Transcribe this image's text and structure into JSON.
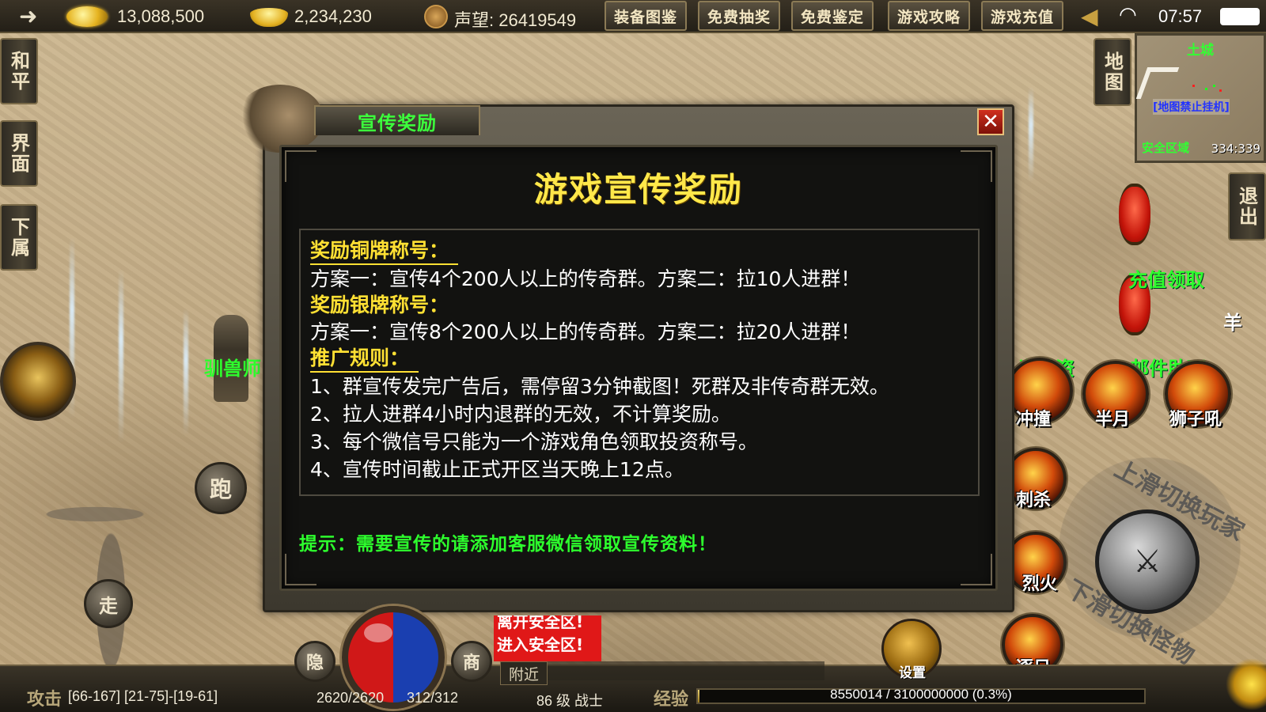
{
  "topbar": {
    "gold": "13,088,500",
    "ingot": "2,234,230",
    "reputation": "声望: 26419549",
    "buttons": [
      "装备图鉴",
      "免费抽奖",
      "免费鉴定",
      "游戏攻略",
      "游戏充值"
    ],
    "time": "07:57"
  },
  "left_menu": [
    "和平",
    "界面",
    "下属"
  ],
  "right_menu": [
    "地图",
    "退出"
  ],
  "minimap": {
    "title": "土城",
    "warning": "[地图禁止挂机]",
    "zone": "安全区域",
    "coords": "334:339"
  },
  "dialog": {
    "tab_title": "宣传奖励",
    "close_label": "✕",
    "heading": "游戏宣传奖励",
    "sections": [
      {
        "title": "奖励铜牌称号：",
        "lines": [
          "方案一：宣传4个200人以上的传奇群。方案二：拉10人进群！"
        ]
      },
      {
        "title": "奖励银牌称号：",
        "lines": [
          "方案一：宣传8个200人以上的传奇群。方案二：拉20人进群！"
        ]
      },
      {
        "title": "推广规则：",
        "lines": [
          "1、群宣传发完广告后，需停留3分钟截图！死群及非传奇群无效。",
          "2、拉人进群4小时内退群的无效，不计算奖励。",
          "3、每个微信号只能为一个游戏角色领取投资称号。",
          "4、宣传时间截止正式开区当天晚上12点。"
        ]
      }
    ],
    "tip": "提示：需要宣传的请添加客服微信领取宣传资料！"
  },
  "right_panel": {
    "recharge_label": "充值领取",
    "mail_label": "邮件助理",
    "invest_label": "光投资",
    "sheep_label": "羊",
    "skills": [
      "冲撞",
      "半月",
      "狮子吼",
      "刺杀",
      "烈火",
      "逐日"
    ],
    "wheel_up": "上滑切换玩家",
    "wheel_down": "下滑切换怪物"
  },
  "left_controls": {
    "run_label": "跑",
    "walk_label": "走",
    "npc_name": "驯兽师",
    "sheep_label": "羊"
  },
  "hud": {
    "mode_label": "攻击",
    "stats": "[66-167] [21-75]-[19-61]",
    "hide_label": "隐",
    "shop_label": "商",
    "hp": "2620/2620",
    "mp": "312/312",
    "level": "86 级  战士",
    "exp_label": "经验",
    "exp_value": "8550014 / 3100000000 (0.3%)",
    "exp_fraction": 0.003,
    "safe_zone_lines": [
      "离开安全区!",
      "进入安全区!"
    ],
    "nearby_tab": "附近",
    "settings_label": "设置"
  }
}
